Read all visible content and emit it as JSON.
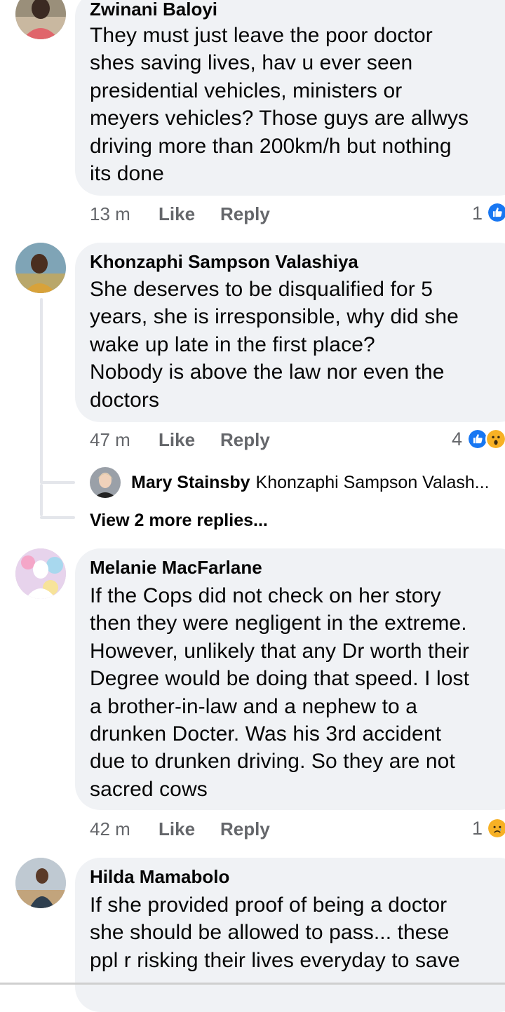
{
  "comments": [
    {
      "author": "Zwinani Baloyi",
      "text": "They must just leave the poor doctor\nshes saving lives, hav u ever seen\npresidential vehicles, ministers or\nmeyers vehicles? Those guys are allwys\ndriving more than 200km/h  but nothing\nits done",
      "time": "13 m",
      "like_label": "Like",
      "reply_label": "Reply",
      "reaction_count": "1",
      "reactions": [
        "like-icon"
      ]
    },
    {
      "author": "Khonzaphi Sampson Valashiya",
      "text": "She deserves to be disqualified for 5\nyears, she is irresponsible, why did she\nwake up late in the first place?\nNobody is above the law nor even the\ndoctors",
      "time": "47 m",
      "like_label": "Like",
      "reply_label": "Reply",
      "reaction_count": "4",
      "reactions": [
        "like-icon",
        "wow-icon"
      ],
      "reply_preview": {
        "author": "Mary Stainsby",
        "snippet": "Khonzaphi Sampson Valash..."
      },
      "more_replies_label": "View 2 more replies..."
    },
    {
      "author": "Melanie MacFarlane",
      "text": "If the Cops did not check on her story\nthen they were negligent in the extreme.\nHowever, unlikely that any Dr worth their\nDegree would be doing that speed. I lost\na brother-in-law and a nephew to a\ndrunken Docter. Was his 3rd accident\ndue to drunken driving. So they are not\nsacred cows",
      "time": "42 m",
      "like_label": "Like",
      "reply_label": "Reply",
      "reaction_count": "1",
      "reactions": [
        "sad-icon"
      ]
    },
    {
      "author": "Hilda Mamabolo",
      "text": "If she provided proof of being a doctor\nshe should be allowed to pass... these\nppl r risking their lives everyday to save"
    }
  ],
  "colors": {
    "bubble": "#f0f2f5",
    "meta_text": "#65676b",
    "like_blue": "#1877f2",
    "reaction_yellow": "#f7b125"
  }
}
